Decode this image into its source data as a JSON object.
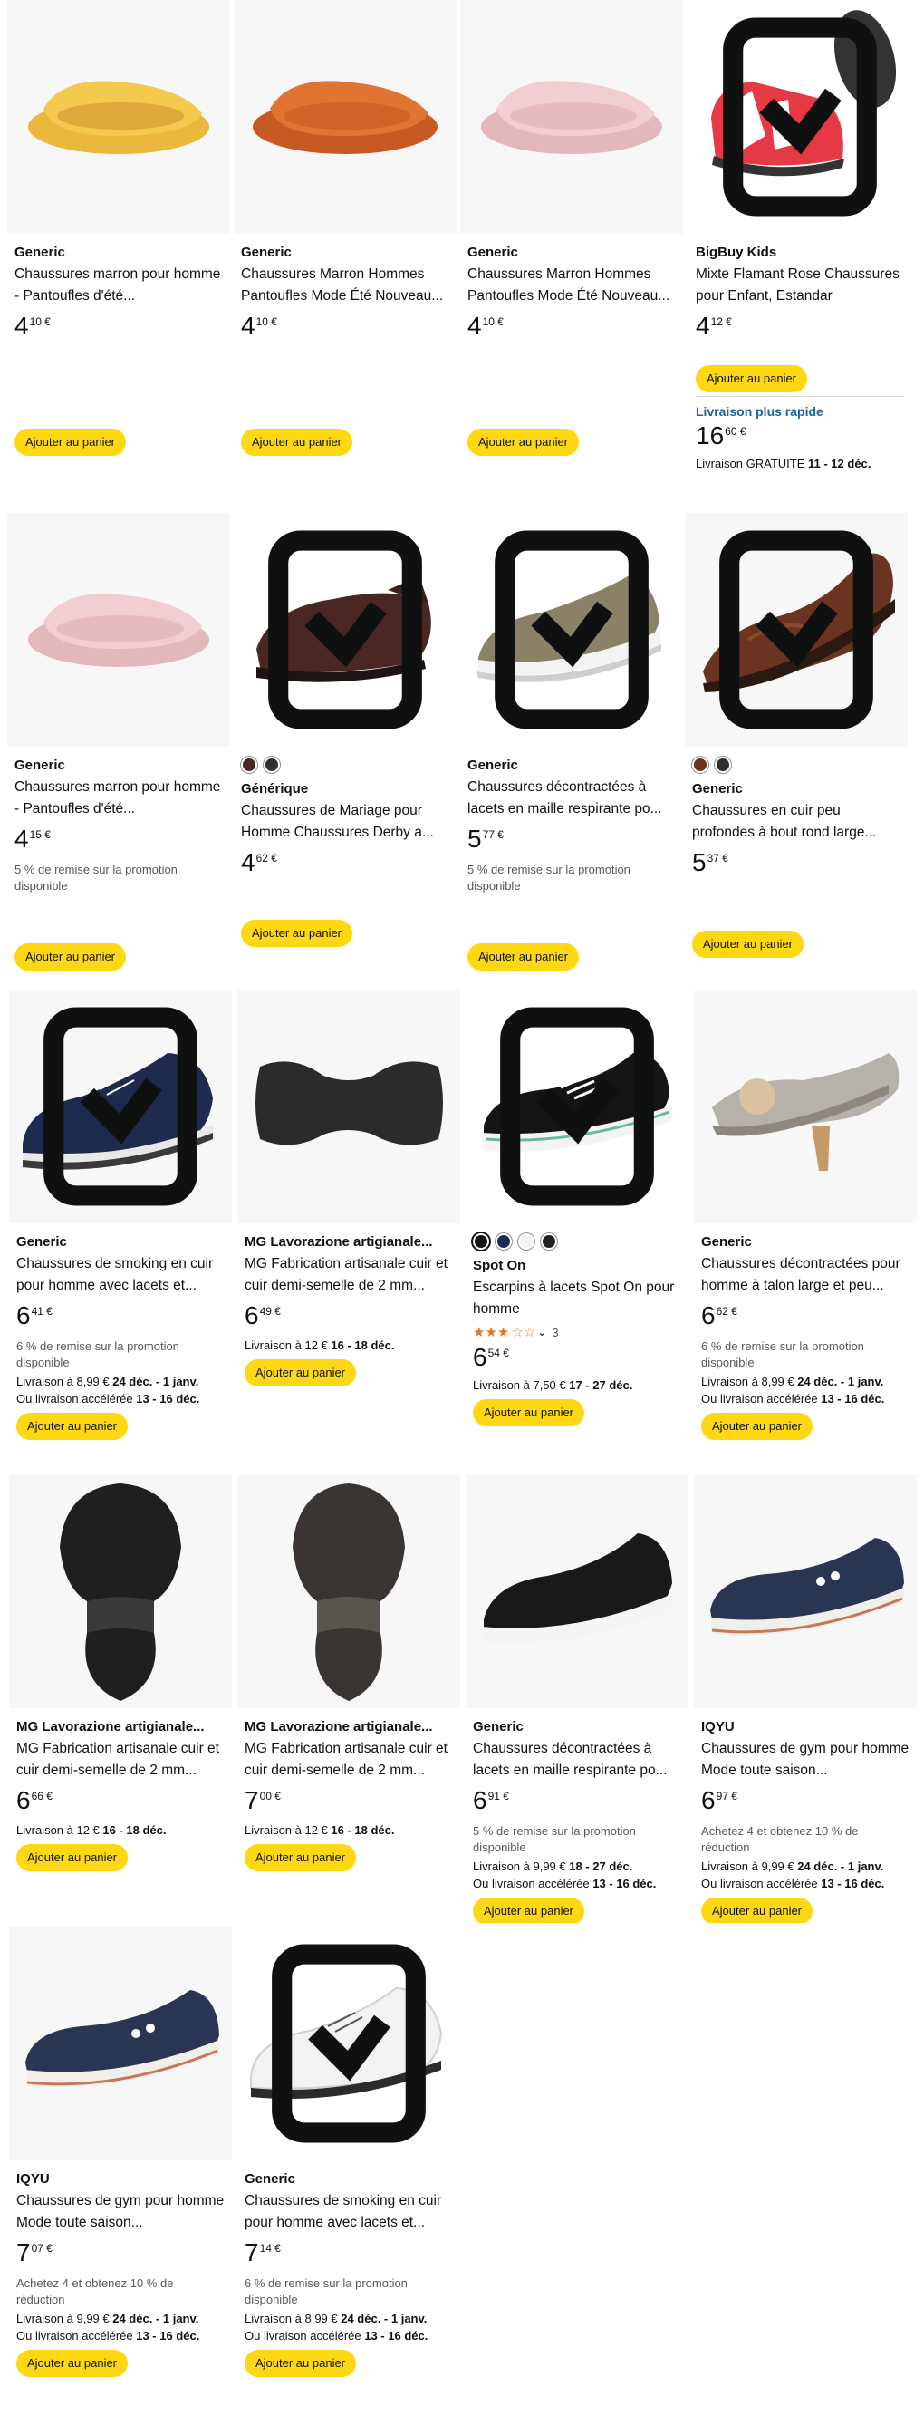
{
  "products": [
    {
      "brand": "Generic",
      "title": "Chaussures marron pour homme - Pantoufles d'été...",
      "price_whole": "4",
      "price_frac": "10 €",
      "button": "Ajouter au panier",
      "image": "slipper-yellow"
    },
    {
      "brand": "Generic",
      "title": "Chaussures Marron Hommes Pantoufles Mode Été Nouveau...",
      "price_whole": "4",
      "price_frac": "10 €",
      "button": "Ajouter au panier",
      "image": "slipper-orange"
    },
    {
      "brand": "Generic",
      "title": "Chaussures Marron Hommes Pantoufles Mode Été Nouveau...",
      "price_whole": "4",
      "price_frac": "10 €",
      "button": "Ajouter au panier",
      "image": "slipper-pink"
    },
    {
      "brand": "BigBuy Kids",
      "title": "Mixte Flamant Rose Chaussures pour Enfant, Estandar",
      "price_whole": "4",
      "price_frac": "12 €",
      "button": "Ajouter au panier",
      "fast_label": "Livraison plus rapide",
      "fast_price_whole": "16",
      "fast_price_frac": "60 €",
      "fast_delivery_prefix": "Livraison GRATUITE ",
      "fast_delivery_dates": "11 - 12 déc.",
      "image": "kids-water-shoe"
    },
    {
      "brand": "Generic",
      "title": "Chaussures marron pour homme - Pantoufles d'été...",
      "price_whole": "4",
      "price_frac": "15 €",
      "promo": "5 % de remise sur la promotion disponible",
      "button": "Ajouter au panier",
      "image": "slipper-pink"
    },
    {
      "brand": "Générique",
      "title": "Chaussures de Mariage pour Homme Chaussures Derby a...",
      "price_whole": "4",
      "price_frac": "62 €",
      "button": "Ajouter au panier",
      "image": "derby-brown"
    },
    {
      "brand": "Generic",
      "title": "Chaussures décontractées à lacets en maille respirante po...",
      "price_whole": "5",
      "price_frac": "77 €",
      "promo": "5 % de remise sur la promotion disponible",
      "button": "Ajouter au panier",
      "image": "knit-olive"
    },
    {
      "brand": "Generic",
      "title": "Chaussures en cuir peu profondes à bout rond large...",
      "price_whole": "5",
      "price_frac": "37 €",
      "button": "Ajouter au panier",
      "image": "loafer-brown"
    },
    {
      "brand": "Generic",
      "title": "Chaussures de smoking en cuir pour homme avec lacets et...",
      "price_whole": "6",
      "price_frac": "41 €",
      "promo": "6 % de remise sur la promotion disponible",
      "delivery1_prefix": "Livraison à 8,99 € ",
      "delivery1_dates": "24 déc. - 1 janv.",
      "delivery2_prefix": "Ou livraison accélérée ",
      "delivery2_dates": "13 - 16 déc.",
      "button": "Ajouter au panier",
      "image": "smoking-navy"
    },
    {
      "brand": "MG Lavorazione artigianale...",
      "title": "MG Fabrication artisanale cuir et cuir demi-semelle de 2 mm...",
      "price_whole": "6",
      "price_frac": "49 €",
      "delivery1_prefix": "Livraison à 12 € ",
      "delivery1_dates": "16 - 18 déc.",
      "button": "Ajouter au panier",
      "image": "sole-flat"
    },
    {
      "brand": "Spot On",
      "title": "Escarpins à lacets Spot On pour homme",
      "price_whole": "6",
      "price_frac": "54 €",
      "rating_count": "3",
      "delivery1_prefix": "Livraison à 7,50 € ",
      "delivery1_dates": "17 - 27 déc.",
      "button": "Ajouter au panier",
      "image": "canvas-black"
    },
    {
      "brand": "Generic",
      "title": "Chaussures décontractées pour homme à talon large et peu...",
      "price_whole": "6",
      "price_frac": "62 €",
      "promo": "6 % de remise sur la promotion disponible",
      "delivery1_prefix": "Livraison à 8,99 € ",
      "delivery1_dates": "24 déc. - 1 janv.",
      "delivery2_prefix": "Ou livraison accélérée ",
      "delivery2_dates": "13 - 16 déc.",
      "button": "Ajouter au panier",
      "image": "pump-grey"
    },
    {
      "brand": "MG Lavorazione artigianale...",
      "title": "MG Fabrication artisanale cuir et cuir demi-semelle de 2 mm...",
      "price_whole": "6",
      "price_frac": "66 €",
      "delivery1_prefix": "Livraison à 12 € ",
      "delivery1_dates": "16 - 18 déc.",
      "button": "Ajouter au panier",
      "image": "sole-black"
    },
    {
      "brand": "MG Lavorazione artigianale...",
      "title": "MG Fabrication artisanale cuir et cuir demi-semelle de 2 mm...",
      "price_whole": "7",
      "price_frac": "00 €",
      "delivery1_prefix": "Livraison à 12 € ",
      "delivery1_dates": "16 - 18 déc.",
      "button": "Ajouter au panier",
      "image": "sole-dark"
    },
    {
      "brand": "Generic",
      "title": "Chaussures décontractées à lacets en maille respirante po...",
      "price_whole": "6",
      "price_frac": "91 €",
      "promo": "5 % de remise sur la promotion disponible",
      "delivery1_prefix": "Livraison à 9,99 € ",
      "delivery1_dates": "18 - 27 déc.",
      "delivery2_prefix": "Ou livraison accélérée ",
      "delivery2_dates": "13 - 16 déc.",
      "button": "Ajouter au panier",
      "image": "knit-black"
    },
    {
      "brand": "IQYU",
      "title": "Chaussures de gym pour homme Mode toute saison...",
      "price_whole": "6",
      "price_frac": "97 €",
      "promo": "Achetez 4 et obtenez 10 % de réduction",
      "delivery1_prefix": "Livraison à 9,99 € ",
      "delivery1_dates": "24 déc. - 1 janv.",
      "delivery2_prefix": "Ou livraison accélérée ",
      "delivery2_dates": "13 - 16 déc.",
      "button": "Ajouter au panier",
      "image": "gym-navy"
    },
    {
      "brand": "IQYU",
      "title": "Chaussures de gym pour homme Mode toute saison...",
      "price_whole": "7",
      "price_frac": "07 €",
      "promo": "Achetez 4 et obtenez 10 % de réduction",
      "delivery1_prefix": "Livraison à 9,99 € ",
      "delivery1_dates": "24 déc. - 1 janv.",
      "delivery2_prefix": "Ou livraison accélérée ",
      "delivery2_dates": "13 - 16 déc.",
      "button": "Ajouter au panier",
      "image": "gym-navy"
    },
    {
      "brand": "Generic",
      "title": "Chaussures de smoking en cuir pour homme avec lacets et...",
      "price_whole": "7",
      "price_frac": "14 €",
      "promo": "6 % de remise sur la promotion disponible",
      "delivery1_prefix": "Livraison à 8,99 € ",
      "delivery1_dates": "24 déc. - 1 janv.",
      "delivery2_prefix": "Ou livraison accélérée ",
      "delivery2_dates": "13 - 16 déc.",
      "button": "Ajouter au panier",
      "image": "smoking-white"
    }
  ],
  "colors": {
    "button": "#ffd814",
    "link": "#2162a1",
    "muted": "#565959",
    "star": "#de7921"
  }
}
